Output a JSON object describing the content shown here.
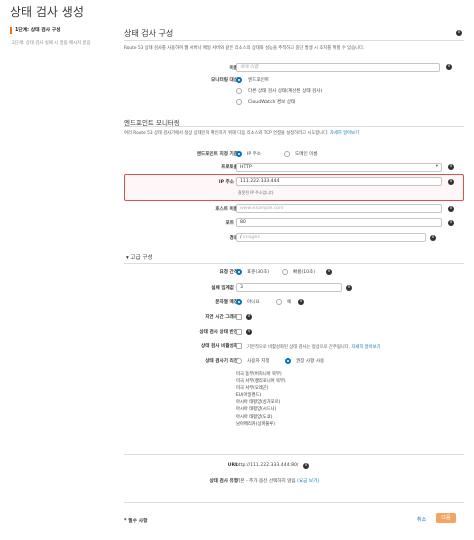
{
  "page": {
    "title": "상태 검사 생성"
  },
  "steps": [
    {
      "label": "1단계: 상태 검사 구성"
    },
    {
      "label": "2단계: 상태 검사 실패 시 알림 메시지 받음"
    }
  ],
  "configure": {
    "title": "상태 검사 구성",
    "description": "Route 53 상태 검사를 사용하여 웹 서버나 메일 서버와 같은 리소스의 상태와 성능을 추적하고 중단 발생 시 조치를 취할 수 있습니다.",
    "name_label": "이름",
    "name_placeholder": "예제 이름",
    "what_to_monitor_label": "모니터링 대상",
    "monitor_options": [
      "엔드포인트",
      "다른 상태 검사 상태(계산된 상태 검사)",
      "CloudWatch 경보 상태"
    ]
  },
  "endpoint": {
    "title": "엔드포인트 모니터링",
    "description": "여러 Route 53 상태 검사기에서 정상 상태인지 확인하기 위해 다음 리소스와 TCP 연결을 설정하려고 시도합니다.",
    "learn_more": "자세히 알아보기",
    "specify_by_label": "엔드포인트 지정 기준",
    "specify_options": [
      "IP 주소",
      "도메인 이름"
    ],
    "protocol_label": "프로토콜",
    "protocol_value": "HTTP",
    "ip_label": "IP 주소 *",
    "ip_value": "111.222.333.444",
    "ip_error": "잘못된 IP 주소입니다",
    "host_label": "호스트 이름",
    "host_placeholder": "www.example.com",
    "port_label": "포트 *",
    "port_value": "80",
    "path_label": "경로",
    "path_prefix": "/",
    "path_placeholder": "images"
  },
  "advanced": {
    "title": "고급 구성",
    "interval_label": "요청 간격",
    "interval_options": [
      "표준(30초)",
      "빠름(10초)"
    ],
    "failure_threshold_label": "실패 임계값 *",
    "failure_threshold_value": "3",
    "string_matching_label": "문자열 매칭",
    "string_matching_options": [
      "아니요",
      "예"
    ],
    "latency_graphs_label": "지연 시간 그래프",
    "invert_label": "상태 검사 상태 반전",
    "disable_label": "상태 검사 비활성화",
    "disable_text": "기본적으로 비활성화된 상태 검사는 정상으로 간주됩니다.",
    "disable_learn_more": "자세히 알아보기",
    "regions_label": "상태 검사기 리전",
    "regions_options": [
      "사용자 지정",
      "권장 사항 사용"
    ],
    "regions": [
      "미국 동부(버지니아 북부)",
      "미국 서부(캘리포니아 북부)",
      "미국 서부(오레곤)",
      "EU(아일랜드)",
      "아시아 태평양(싱가포르)",
      "아시아 태평양(시드니)",
      "아시아 태평양(도쿄)",
      "남아메리카(상파울루)"
    ]
  },
  "summary": {
    "url_label": "URL",
    "url_value": "http://111.222.333.444:80/",
    "type_label": "상태 검사 유형",
    "type_value": "기본 - 추가 옵션 선택하지 않음",
    "type_link": "(요금 보기)"
  },
  "footer": {
    "required_note": "* 필수 사항",
    "cancel": "취소",
    "create": "다음"
  },
  "colors": {
    "accent": "#0073bb",
    "error": "#d9534f",
    "primary_button": "#f4a460"
  }
}
